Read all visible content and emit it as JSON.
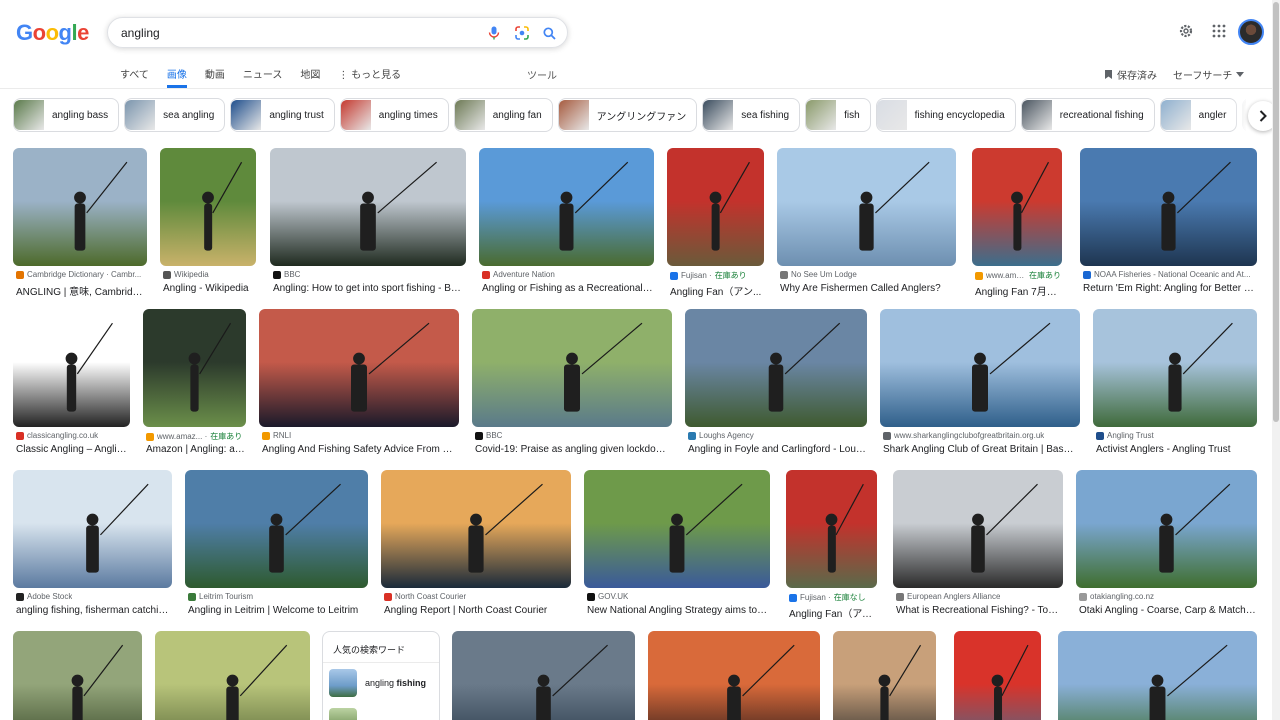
{
  "logo": [
    "G",
    "o",
    "o",
    "g",
    "l",
    "e"
  ],
  "logo_colors": [
    "#4285f4",
    "#ea4335",
    "#fbbc05",
    "#4285f4",
    "#34a853",
    "#ea4335"
  ],
  "search": {
    "query": "angling"
  },
  "tabs": [
    {
      "label": "すべて",
      "active": false
    },
    {
      "label": "画像",
      "active": true
    },
    {
      "label": "動画",
      "active": false
    },
    {
      "label": "ニュース",
      "active": false
    },
    {
      "label": "地図",
      "active": false
    },
    {
      "label": "もっと見る",
      "active": false
    }
  ],
  "tools_label": "ツール",
  "saved_label": "保存済み",
  "safesearch_label": "セーフサーチ",
  "chips": [
    {
      "label": "angling bass",
      "color": "#5a7a4a"
    },
    {
      "label": "sea angling",
      "color": "#7b95ad"
    },
    {
      "label": "angling trust",
      "color": "#1f4e8c"
    },
    {
      "label": "angling times",
      "color": "#c4392f"
    },
    {
      "label": "angling fan",
      "color": "#6d7a55"
    },
    {
      "label": "アングリングファン",
      "color": "#a65b3f"
    },
    {
      "label": "sea fishing",
      "color": "#3a4c5e"
    },
    {
      "label": "fish",
      "color": "#8a9a6a"
    },
    {
      "label": "fishing encyclopedia",
      "color": "#d9dde4"
    },
    {
      "label": "recreational fishing",
      "color": "#4a5560"
    },
    {
      "label": "angler",
      "color": "#8fb0cf"
    },
    {
      "label": "",
      "color": "#cccccc"
    }
  ],
  "results": [
    {
      "source": "Cambridge Dictionary · Cambr...",
      "title": "ANGLING | 意味, Cambridge ...",
      "stock": "",
      "fav": "#e37400",
      "c1": "#9bb2c7",
      "c2": "#4d6a2a"
    },
    {
      "source": "Wikipedia",
      "title": "Angling - Wikipedia",
      "stock": "",
      "fav": "#555555",
      "c1": "#5f8a3c",
      "c2": "#c9b26a"
    },
    {
      "source": "BBC",
      "title": "Angling: How to get into sport fishing - BB...",
      "stock": "",
      "fav": "#111111",
      "c1": "#bfc7cf",
      "c2": "#1f2a1f"
    },
    {
      "source": "Adventure Nation",
      "title": "Angling or Fishing as a Recreational S...",
      "stock": "",
      "fav": "#d93025",
      "c1": "#5a9ad8",
      "c2": "#4a6b2f"
    },
    {
      "source": "Fujisan · ",
      "title": "Angling Fan（アン...",
      "stock": "在庫あり",
      "fav": "#1a73e8",
      "c1": "#c3322c",
      "c2": "#6a5a3a"
    },
    {
      "source": "No See Um Lodge",
      "title": "Why Are Fishermen Called Anglers?",
      "stock": "",
      "fav": "#777777",
      "c1": "#a9c9e6",
      "c2": "#6d8fb0"
    },
    {
      "source": "www.ama... · ",
      "title": "Angling Fan 7月号 |...",
      "stock": "在庫あり",
      "fav": "#f29900",
      "c1": "#cc3a2f",
      "c2": "#3c6e8c"
    },
    {
      "source": "NOAA Fisheries - National Oceanic and At...",
      "title": "Return 'Em Right: Angling for Better Ca...",
      "stock": "",
      "fav": "#1967d2",
      "c1": "#4a7ab0",
      "c2": "#1e3550"
    },
    {
      "source": "classicangling.co.uk",
      "title": "Classic Angling – Anglin...",
      "stock": "",
      "fav": "#d93025",
      "c1": "#ffffff",
      "c2": "#222222"
    },
    {
      "source": "www.amaz... · ",
      "title": "Amazon | Angling: a ...",
      "stock": "在庫あり",
      "fav": "#f29900",
      "c1": "#2c3a2c",
      "c2": "#6b8f4a"
    },
    {
      "source": "RNLI",
      "title": "Angling And Fishing Safety Advice From Th...",
      "stock": "",
      "fav": "#f29900",
      "c1": "#c45a4a",
      "c2": "#1a1a2a"
    },
    {
      "source": "BBC",
      "title": "Covid-19: Praise as angling given lockdown ...",
      "stock": "",
      "fav": "#111111",
      "c1": "#8fb06a",
      "c2": "#5a7a8a"
    },
    {
      "source": "Loughs Agency",
      "title": "Angling in Foyle and Carlingford - Loug...",
      "stock": "",
      "fav": "#2a7ab0",
      "c1": "#6a86a4",
      "c2": "#3f5a2f"
    },
    {
      "source": "www.sharkanglingclubofgreatbritain.org.uk",
      "title": "Shark Angling Club of Great Britain | Based i...",
      "stock": "",
      "fav": "#5f6368",
      "c1": "#9fbfde",
      "c2": "#2f5f8a"
    },
    {
      "source": "Angling Trust",
      "title": "Activist Anglers - Angling Trust",
      "stock": "",
      "fav": "#1f4e8c",
      "c1": "#a7c3dc",
      "c2": "#3f6a3a"
    },
    {
      "source": "Adobe Stock",
      "title": "angling fishing, fisherman catchin...",
      "stock": "",
      "fav": "#222222",
      "c1": "#d8e4ee",
      "c2": "#5b7aa0"
    },
    {
      "source": "Leitrim Tourism",
      "title": "Angling in Leitrim | Welcome to Leitrim",
      "stock": "",
      "fav": "#3a7a3a",
      "c1": "#4f7ea8",
      "c2": "#2e5a2e"
    },
    {
      "source": "North Coast Courier",
      "title": "Angling Report | North Coast Courier",
      "stock": "",
      "fav": "#d93025",
      "c1": "#e6a85a",
      "c2": "#1a2a3a"
    },
    {
      "source": "GOV.UK",
      "title": "New National Angling Strategy aims to g...",
      "stock": "",
      "fav": "#111111",
      "c1": "#6e9a4a",
      "c2": "#3a5a9a"
    },
    {
      "source": "Fujisan · ",
      "title": "Angling Fan（アン...",
      "stock": "在庫なし",
      "fav": "#1a73e8",
      "c1": "#c3322c",
      "c2": "#5a6a4a"
    },
    {
      "source": "European Anglers Alliance",
      "title": "What is Recreational Fishing? - Topic...",
      "stock": "",
      "fav": "#777777",
      "c1": "#c9cdd2",
      "c2": "#2a2a2a"
    },
    {
      "source": "otakiangling.co.nz",
      "title": "Otaki Angling - Coarse, Carp & Match Fi...",
      "stock": "",
      "fav": "#999999",
      "c1": "#7aa6d0",
      "c2": "#3f6e2e"
    },
    {
      "source": "",
      "title": "",
      "stock": "",
      "fav": "#ffffff",
      "c1": "#93a57a",
      "c2": "#3a4a2a"
    },
    {
      "source": "",
      "title": "",
      "stock": "",
      "fav": "#ffffff",
      "c1": "#b8c47a",
      "c2": "#5a6a3a"
    },
    {
      "source": "",
      "title": "",
      "stock": "",
      "fav": "#ffffff",
      "c1": "#6a7a8a",
      "c2": "#2a3a4a"
    },
    {
      "source": "",
      "title": "",
      "stock": "",
      "fav": "#ffffff",
      "c1": "#d96a3a",
      "c2": "#2a1a1a"
    },
    {
      "source": "",
      "title": "",
      "stock": "",
      "fav": "#ffffff",
      "c1": "#c8a07a",
      "c2": "#2a2a2a"
    },
    {
      "source": "",
      "title": "",
      "stock": "",
      "fav": "#ffffff",
      "c1": "#d9332a",
      "c2": "#4a6a8a"
    },
    {
      "source": "",
      "title": "",
      "stock": "",
      "fav": "#ffffff",
      "c1": "#8ab0d8",
      "c2": "#3a6a2a"
    }
  ],
  "related": {
    "title": "人気の検索ワード",
    "item_prefix": "angling ",
    "item_bold": "fishing"
  }
}
